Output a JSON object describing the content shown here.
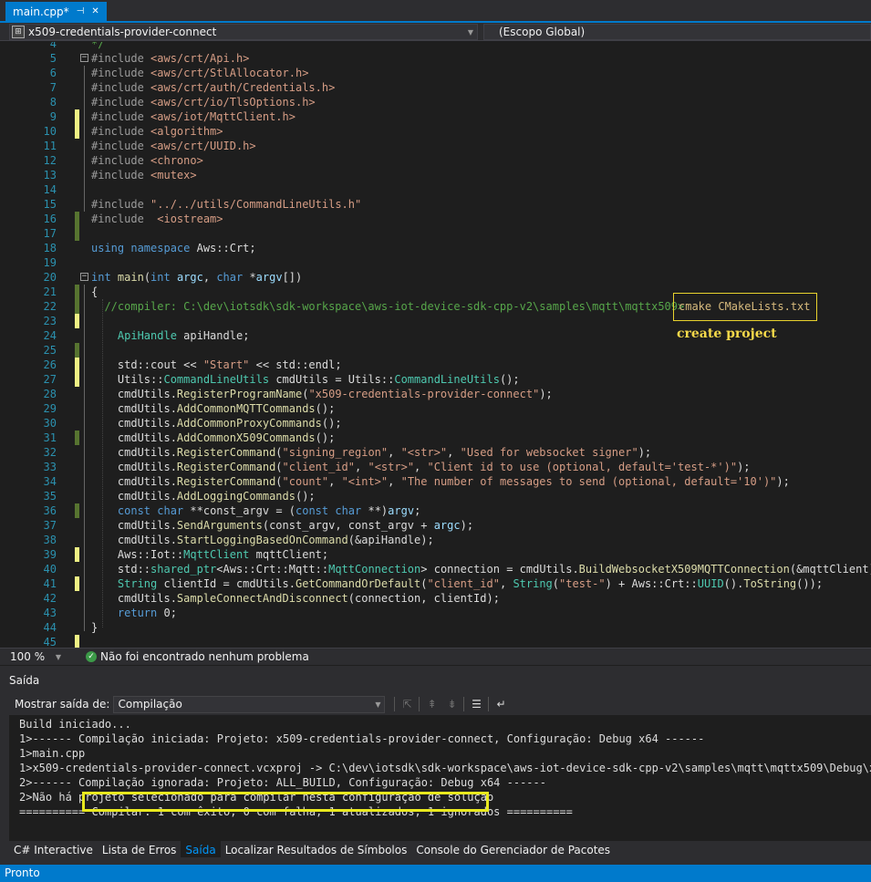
{
  "tab": {
    "label": "main.cpp*",
    "pin_glyph": "⊣",
    "close_glyph": "✕"
  },
  "nav": {
    "project": "x509-credentials-provider-connect",
    "scope": "(Escopo Global)"
  },
  "editor": {
    "lines": [
      {
        "n": "4",
        "chg": "",
        "fold": "",
        "spans": [
          {
            "c": "cm",
            "t": "*/"
          }
        ]
      },
      {
        "n": "5",
        "chg": "",
        "fold": "−",
        "spans": [
          {
            "c": "pp",
            "t": "#include "
          },
          {
            "c": "inc",
            "t": "<aws/crt/Api.h>"
          }
        ]
      },
      {
        "n": "6",
        "chg": "",
        "fold": "",
        "spans": [
          {
            "c": "pp",
            "t": "#include "
          },
          {
            "c": "inc",
            "t": "<aws/crt/StlAllocator.h>"
          }
        ]
      },
      {
        "n": "7",
        "chg": "",
        "fold": "",
        "spans": [
          {
            "c": "pp",
            "t": "#include "
          },
          {
            "c": "inc",
            "t": "<aws/crt/auth/Credentials.h>"
          }
        ]
      },
      {
        "n": "8",
        "chg": "",
        "fold": "",
        "spans": [
          {
            "c": "pp",
            "t": "#include "
          },
          {
            "c": "inc",
            "t": "<aws/crt/io/TlsOptions.h>"
          }
        ]
      },
      {
        "n": "9",
        "chg": "y",
        "fold": "",
        "spans": [
          {
            "c": "pp",
            "t": "#include "
          },
          {
            "c": "inc",
            "t": "<aws/iot/MqttClient.h>"
          }
        ]
      },
      {
        "n": "10",
        "chg": "y",
        "fold": "",
        "spans": [
          {
            "c": "pp",
            "t": "#include "
          },
          {
            "c": "inc",
            "t": "<algorithm>"
          }
        ]
      },
      {
        "n": "11",
        "chg": "",
        "fold": "",
        "spans": [
          {
            "c": "pp",
            "t": "#include "
          },
          {
            "c": "inc",
            "t": "<aws/crt/UUID.h>"
          }
        ]
      },
      {
        "n": "12",
        "chg": "",
        "fold": "",
        "spans": [
          {
            "c": "pp",
            "t": "#include "
          },
          {
            "c": "inc",
            "t": "<chrono>"
          }
        ]
      },
      {
        "n": "13",
        "chg": "",
        "fold": "",
        "spans": [
          {
            "c": "pp",
            "t": "#include "
          },
          {
            "c": "inc",
            "t": "<mutex>"
          }
        ]
      },
      {
        "n": "14",
        "chg": "",
        "fold": "",
        "spans": []
      },
      {
        "n": "15",
        "chg": "",
        "fold": "",
        "spans": [
          {
            "c": "pp",
            "t": "#include "
          },
          {
            "c": "inc",
            "t": "\"../../utils/CommandLineUtils.h\""
          }
        ]
      },
      {
        "n": "16",
        "chg": "g",
        "fold": "",
        "spans": [
          {
            "c": "pp",
            "t": "#include  "
          },
          {
            "c": "inc",
            "t": "<iostream>"
          }
        ]
      },
      {
        "n": "17",
        "chg": "g",
        "fold": "",
        "spans": []
      },
      {
        "n": "18",
        "chg": "",
        "fold": "",
        "spans": [
          {
            "c": "kw",
            "t": "using namespace "
          },
          {
            "c": "id",
            "t": "Aws::Crt;"
          }
        ]
      },
      {
        "n": "19",
        "chg": "",
        "fold": "",
        "spans": []
      },
      {
        "n": "20",
        "chg": "",
        "fold": "−",
        "spans": [
          {
            "c": "kw",
            "t": "int "
          },
          {
            "c": "fn",
            "t": "main"
          },
          {
            "c": "id",
            "t": "("
          },
          {
            "c": "kw",
            "t": "int "
          },
          {
            "c": "vr",
            "t": "argc"
          },
          {
            "c": "id",
            "t": ", "
          },
          {
            "c": "kw",
            "t": "char "
          },
          {
            "c": "id",
            "t": "*"
          },
          {
            "c": "vr",
            "t": "argv"
          },
          {
            "c": "id",
            "t": "[])"
          }
        ]
      },
      {
        "n": "21",
        "chg": "g",
        "fold": "",
        "spans": [
          {
            "c": "id",
            "t": "{"
          }
        ]
      },
      {
        "n": "22",
        "chg": "g",
        "fold": "",
        "spans": [
          {
            "c": "cm",
            "t": "  //compiler: C:\\dev\\iotsdk\\sdk-workspace\\aws-iot-device-sdk-cpp-v2\\samples\\mqtt\\mqttx509>"
          }
        ]
      },
      {
        "n": "23",
        "chg": "y",
        "fold": "",
        "spans": []
      },
      {
        "n": "24",
        "chg": "",
        "fold": "",
        "spans": [
          {
            "c": "id",
            "t": "    "
          },
          {
            "c": "ty",
            "t": "ApiHandle "
          },
          {
            "c": "mb",
            "t": "apiHandle"
          },
          {
            "c": "id",
            "t": ";"
          }
        ]
      },
      {
        "n": "25",
        "chg": "g",
        "fold": "",
        "spans": []
      },
      {
        "n": "26",
        "chg": "y",
        "fold": "",
        "spans": [
          {
            "c": "id",
            "t": "    std::cout << "
          },
          {
            "c": "str",
            "t": "\"Start\""
          },
          {
            "c": "id",
            "t": " << std::endl;"
          }
        ]
      },
      {
        "n": "27",
        "chg": "y",
        "fold": "",
        "spans": [
          {
            "c": "id",
            "t": "    Utils::"
          },
          {
            "c": "ty",
            "t": "CommandLineUtils "
          },
          {
            "c": "mb",
            "t": "cmdUtils"
          },
          {
            "c": "id",
            "t": " = Utils::"
          },
          {
            "c": "ty",
            "t": "CommandLineUtils"
          },
          {
            "c": "id",
            "t": "();"
          }
        ]
      },
      {
        "n": "28",
        "chg": "",
        "fold": "",
        "spans": [
          {
            "c": "id",
            "t": "    cmdUtils."
          },
          {
            "c": "fn",
            "t": "RegisterProgramName"
          },
          {
            "c": "id",
            "t": "("
          },
          {
            "c": "str",
            "t": "\"x509-credentials-provider-connect\""
          },
          {
            "c": "id",
            "t": ");"
          }
        ]
      },
      {
        "n": "29",
        "chg": "",
        "fold": "",
        "spans": [
          {
            "c": "id",
            "t": "    cmdUtils."
          },
          {
            "c": "fn",
            "t": "AddCommonMQTTCommands"
          },
          {
            "c": "id",
            "t": "();"
          }
        ]
      },
      {
        "n": "30",
        "chg": "",
        "fold": "",
        "spans": [
          {
            "c": "id",
            "t": "    cmdUtils."
          },
          {
            "c": "fn",
            "t": "AddCommonProxyCommands"
          },
          {
            "c": "id",
            "t": "();"
          }
        ]
      },
      {
        "n": "31",
        "chg": "g",
        "fold": "",
        "spans": [
          {
            "c": "id",
            "t": "    cmdUtils."
          },
          {
            "c": "fn",
            "t": "AddCommonX509Commands"
          },
          {
            "c": "id",
            "t": "();"
          }
        ]
      },
      {
        "n": "32",
        "chg": "",
        "fold": "",
        "spans": [
          {
            "c": "id",
            "t": "    cmdUtils."
          },
          {
            "c": "fn",
            "t": "RegisterCommand"
          },
          {
            "c": "id",
            "t": "("
          },
          {
            "c": "str",
            "t": "\"signing_region\""
          },
          {
            "c": "id",
            "t": ", "
          },
          {
            "c": "str",
            "t": "\"<str>\""
          },
          {
            "c": "id",
            "t": ", "
          },
          {
            "c": "str",
            "t": "\"Used for websocket signer\""
          },
          {
            "c": "id",
            "t": ");"
          }
        ]
      },
      {
        "n": "33",
        "chg": "",
        "fold": "",
        "spans": [
          {
            "c": "id",
            "t": "    cmdUtils."
          },
          {
            "c": "fn",
            "t": "RegisterCommand"
          },
          {
            "c": "id",
            "t": "("
          },
          {
            "c": "str",
            "t": "\"client_id\""
          },
          {
            "c": "id",
            "t": ", "
          },
          {
            "c": "str",
            "t": "\"<str>\""
          },
          {
            "c": "id",
            "t": ", "
          },
          {
            "c": "str",
            "t": "\"Client id to use (optional, default='test-*')\""
          },
          {
            "c": "id",
            "t": ");"
          }
        ]
      },
      {
        "n": "34",
        "chg": "",
        "fold": "",
        "spans": [
          {
            "c": "id",
            "t": "    cmdUtils."
          },
          {
            "c": "fn",
            "t": "RegisterCommand"
          },
          {
            "c": "id",
            "t": "("
          },
          {
            "c": "str",
            "t": "\"count\""
          },
          {
            "c": "id",
            "t": ", "
          },
          {
            "c": "str",
            "t": "\"<int>\""
          },
          {
            "c": "id",
            "t": ", "
          },
          {
            "c": "str",
            "t": "\"The number of messages to send (optional, default='10')\""
          },
          {
            "c": "id",
            "t": ");"
          }
        ]
      },
      {
        "n": "35",
        "chg": "",
        "fold": "",
        "spans": [
          {
            "c": "id",
            "t": "    cmdUtils."
          },
          {
            "c": "fn",
            "t": "AddLoggingCommands"
          },
          {
            "c": "id",
            "t": "();"
          }
        ]
      },
      {
        "n": "36",
        "chg": "g",
        "fold": "",
        "spans": [
          {
            "c": "id",
            "t": "    "
          },
          {
            "c": "kw",
            "t": "const char "
          },
          {
            "c": "id",
            "t": "**"
          },
          {
            "c": "mb",
            "t": "const_argv"
          },
          {
            "c": "id",
            "t": " = ("
          },
          {
            "c": "kw",
            "t": "const char "
          },
          {
            "c": "id",
            "t": "**)"
          },
          {
            "c": "vr",
            "t": "argv"
          },
          {
            "c": "id",
            "t": ";"
          }
        ]
      },
      {
        "n": "37",
        "chg": "",
        "fold": "",
        "spans": [
          {
            "c": "id",
            "t": "    cmdUtils."
          },
          {
            "c": "fn",
            "t": "SendArguments"
          },
          {
            "c": "id",
            "t": "(const_argv, const_argv + "
          },
          {
            "c": "vr",
            "t": "argc"
          },
          {
            "c": "id",
            "t": ");"
          }
        ]
      },
      {
        "n": "38",
        "chg": "",
        "fold": "",
        "spans": [
          {
            "c": "id",
            "t": "    cmdUtils."
          },
          {
            "c": "fn",
            "t": "StartLoggingBasedOnCommand"
          },
          {
            "c": "id",
            "t": "(&apiHandle);"
          }
        ]
      },
      {
        "n": "39",
        "chg": "y",
        "fold": "",
        "spans": [
          {
            "c": "id",
            "t": "    Aws::Iot::"
          },
          {
            "c": "ty",
            "t": "MqttClient "
          },
          {
            "c": "mb",
            "t": "mqttClient"
          },
          {
            "c": "id",
            "t": ";"
          }
        ]
      },
      {
        "n": "40",
        "chg": "",
        "fold": "",
        "spans": [
          {
            "c": "id",
            "t": "    std::"
          },
          {
            "c": "ty",
            "t": "shared_ptr"
          },
          {
            "c": "id",
            "t": "<Aws::Crt::Mqtt::"
          },
          {
            "c": "ty",
            "t": "MqttConnection"
          },
          {
            "c": "id",
            "t": "> "
          },
          {
            "c": "mb",
            "t": "connection"
          },
          {
            "c": "id",
            "t": " = cmdUtils."
          },
          {
            "c": "fn",
            "t": "BuildWebsocketX509MQTTConnection"
          },
          {
            "c": "id",
            "t": "(&mqttClient);"
          }
        ]
      },
      {
        "n": "41",
        "chg": "y",
        "fold": "",
        "spans": [
          {
            "c": "id",
            "t": "    "
          },
          {
            "c": "ty",
            "t": "String "
          },
          {
            "c": "mb",
            "t": "clientId"
          },
          {
            "c": "id",
            "t": " = cmdUtils."
          },
          {
            "c": "fn",
            "t": "GetCommandOrDefault"
          },
          {
            "c": "id",
            "t": "("
          },
          {
            "c": "str",
            "t": "\"client_id\""
          },
          {
            "c": "id",
            "t": ", "
          },
          {
            "c": "ty",
            "t": "String"
          },
          {
            "c": "id",
            "t": "("
          },
          {
            "c": "str",
            "t": "\"test-\""
          },
          {
            "c": "id",
            "t": ") + Aws::Crt::"
          },
          {
            "c": "ty",
            "t": "UUID"
          },
          {
            "c": "id",
            "t": "()."
          },
          {
            "c": "fn",
            "t": "ToString"
          },
          {
            "c": "id",
            "t": "());"
          }
        ]
      },
      {
        "n": "42",
        "chg": "",
        "fold": "",
        "spans": [
          {
            "c": "id",
            "t": "    cmdUtils."
          },
          {
            "c": "fn",
            "t": "SampleConnectAndDisconnect"
          },
          {
            "c": "id",
            "t": "(connection, clientId);"
          }
        ]
      },
      {
        "n": "43",
        "chg": "",
        "fold": "",
        "spans": [
          {
            "c": "id",
            "t": "    "
          },
          {
            "c": "kw",
            "t": "return "
          },
          {
            "c": "id",
            "t": "0;"
          }
        ]
      },
      {
        "n": "44",
        "chg": "",
        "fold": "",
        "spans": [
          {
            "c": "id",
            "t": "}"
          }
        ]
      },
      {
        "n": "45",
        "chg": "y",
        "fold": "",
        "spans": []
      }
    ],
    "annotation_command": "cmake CMakeLists.txt",
    "annotation_label": "create project"
  },
  "editor_status": {
    "zoom": "100 %",
    "message": "Não foi encontrado nenhum problema"
  },
  "output_panel": {
    "title": "Saída",
    "show_label": "Mostrar saída de:",
    "source": "Compilação",
    "lines": [
      "Build iniciado...",
      "1>------ Compilação iniciada: Projeto: x509-credentials-provider-connect, Configuração: Debug x64 ------",
      "1>main.cpp",
      "1>x509-credentials-provider-connect.vcxproj -> C:\\dev\\iotsdk\\sdk-workspace\\aws-iot-device-sdk-cpp-v2\\samples\\mqtt\\mqttx509\\Debug\\x509-",
      "2>------ Compilação ignorada: Projeto: ALL_BUILD, Configuração: Debug x64 ------",
      "2>Não há projeto selecionado para compilar nesta configuração de solução",
      "========== Compilar: 1 com êxito, 0 com falha, 1 atualizados, 1 ignorados =========="
    ]
  },
  "bottom_tabs": [
    "C# Interactive",
    "Lista de Erros",
    "Saída",
    "Localizar Resultados de Símbolos",
    "Console do Gerenciador de Pacotes"
  ],
  "status_bar": {
    "text": "Pronto"
  }
}
